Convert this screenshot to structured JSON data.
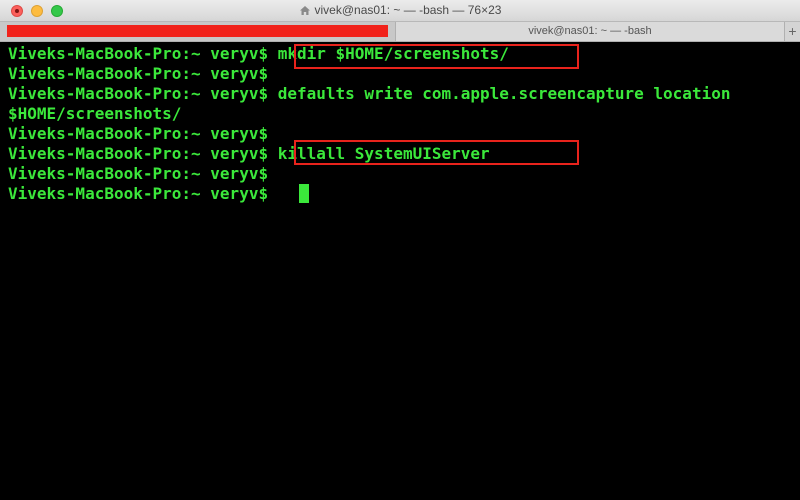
{
  "window": {
    "title": "vivek@nas01: ~ — -bash — 76×23"
  },
  "tabs": [
    {
      "label": ""
    },
    {
      "label": "vivek@nas01: ~ — -bash"
    }
  ],
  "tab_add_label": "+",
  "terminal": {
    "lines": [
      {
        "prompt": "Viveks-MacBook-Pro:~ veryv$",
        "command": " mkdir $HOME/screenshots/"
      },
      {
        "prompt": "Viveks-MacBook-Pro:~ veryv$",
        "command": ""
      },
      {
        "prompt": "Viveks-MacBook-Pro:~ veryv$",
        "command": " defaults write com.apple.screencapture location"
      },
      {
        "prompt": "",
        "command": "$HOME/screenshots/"
      },
      {
        "prompt": "Viveks-MacBook-Pro:~ veryv$",
        "command": ""
      },
      {
        "prompt": "Viveks-MacBook-Pro:~ veryv$",
        "command": " killall SystemUIServer"
      },
      {
        "prompt": "Viveks-MacBook-Pro:~ veryv$",
        "command": ""
      },
      {
        "prompt": "Viveks-MacBook-Pro:~ veryv$",
        "command": " "
      }
    ]
  },
  "colors": {
    "terminal_text": "#3be83b",
    "terminal_background": "#000000",
    "highlight_box": "#e8231c",
    "redaction": "#f1221a"
  }
}
